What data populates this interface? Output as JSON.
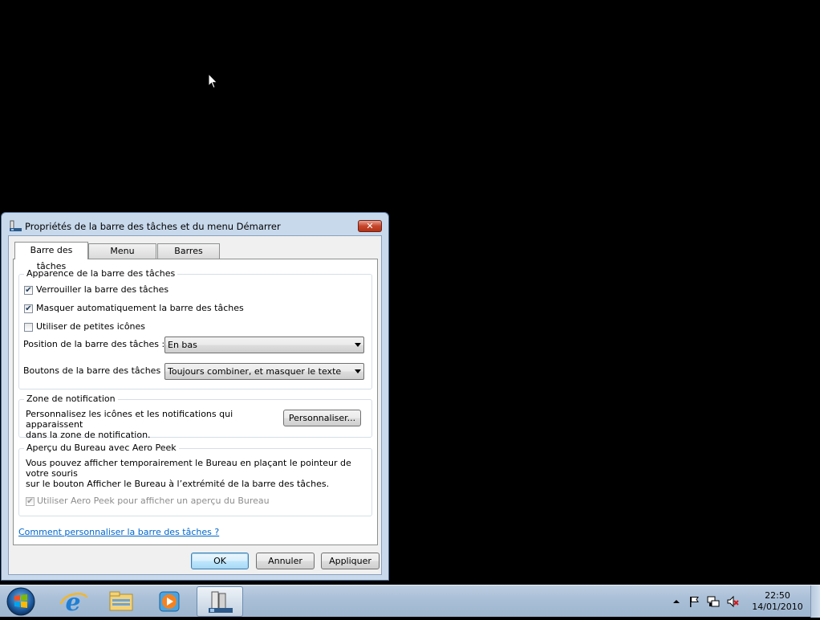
{
  "dialog": {
    "title": "Propriétés de la barre des tâches et du menu Démarrer",
    "close_glyph": "✕",
    "tabs": [
      {
        "label": "Barre des tâches",
        "active": true
      },
      {
        "label": "Menu Démarrer",
        "active": false
      },
      {
        "label": "Barres d’outils",
        "active": false
      }
    ],
    "appearance": {
      "title": "Apparence de la barre des tâches",
      "lock": {
        "label": "Verrouiller la barre des tâches",
        "checked": true
      },
      "autohide": {
        "label": "Masquer automatiquement la barre des tâches",
        "checked": true
      },
      "small_icons": {
        "label": "Utiliser de petites icônes",
        "checked": false
      },
      "position_label": "Position de la barre des tâches :",
      "position_value": "En bas",
      "buttons_label": "Boutons de la barre des tâches :",
      "buttons_value": "Toujours combiner, et masquer le texte"
    },
    "notification": {
      "title": "Zone de notification",
      "desc_line1": "Personnalisez les icônes et les notifications qui apparaissent",
      "desc_line2": "dans la zone de notification.",
      "customize_button": "Personnaliser..."
    },
    "aero_peek": {
      "title": "Aperçu du Bureau avec Aero Peek",
      "desc_line1": "Vous pouvez afficher temporairement le Bureau en plaçant le pointeur de votre souris",
      "desc_line2": "sur le bouton Afficher le Bureau à l’extrémité de la barre des tâches.",
      "use_peek": {
        "label": "Utiliser Aero Peek pour afficher un aperçu du Bureau",
        "checked": true,
        "disabled": true
      }
    },
    "help_link": "Comment personnaliser la barre des tâches ?",
    "buttons": {
      "ok": "OK",
      "cancel": "Annuler",
      "apply": "Appliquer"
    },
    "check_glyph": "✔"
  },
  "taskbar": {
    "icons": [
      "start-orb-icon",
      "internet-explorer-icon",
      "windows-explorer-icon",
      "windows-media-player-icon",
      "taskbar-properties-icon"
    ],
    "tray_icons": [
      "show-hidden-icons-arrow",
      "action-center-flag-icon",
      "network-icon",
      "volume-muted-icon"
    ],
    "time": "22:50",
    "date": "14/01/2010"
  }
}
